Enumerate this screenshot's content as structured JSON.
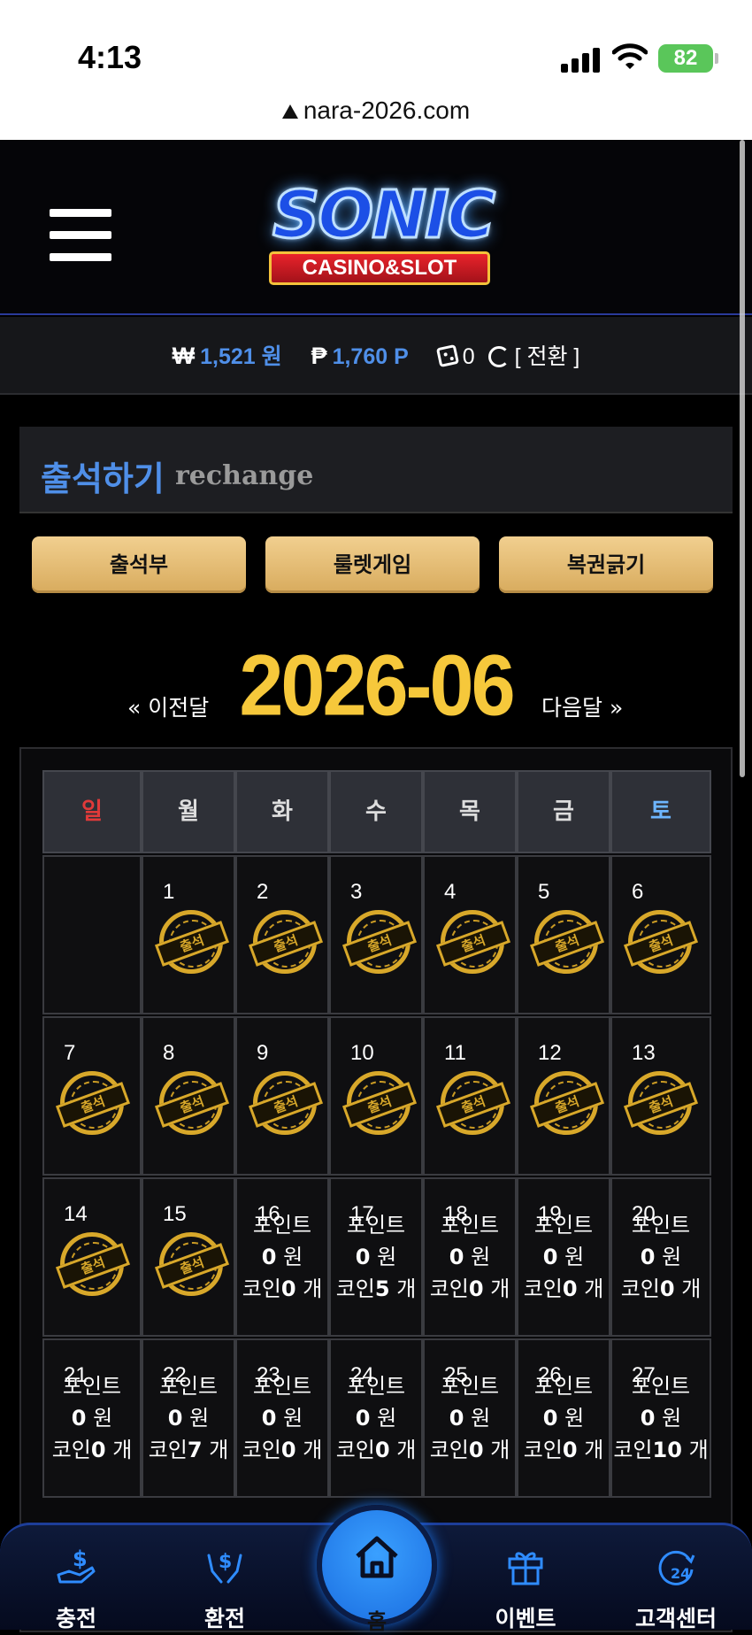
{
  "status": {
    "time": "4:13",
    "battery": "82"
  },
  "browser": {
    "url": "nara-2026.com"
  },
  "logo": {
    "main": "SONIC",
    "sub": "CASINO&SLOT"
  },
  "balance": {
    "won_symbol": "₩",
    "won_value": "1,521 원",
    "point_symbol": "₱",
    "point_value": "1,760 P",
    "coin_value": "0",
    "switch_label": "[ 전환 ]"
  },
  "panel": {
    "title": "출석하기",
    "subtitle": "rechange"
  },
  "tabs": [
    "출석부",
    "룰렛게임",
    "복권긁기"
  ],
  "month_nav": {
    "prev": "« 이전달",
    "current": "2026-06",
    "next": "다음달 »"
  },
  "weekdays": [
    "일",
    "월",
    "화",
    "수",
    "목",
    "금",
    "토"
  ],
  "weekday_colors": {
    "sun": "#e03a3a",
    "sat": "#6db6ff",
    "normal": "#dddddd"
  },
  "stamp_label": "출석",
  "info_labels": {
    "point": "포인트",
    "won_unit": "원",
    "coin": "코인",
    "coin_unit": "개"
  },
  "weeks": [
    [
      null,
      {
        "day": "1",
        "attended": true
      },
      {
        "day": "2",
        "attended": true
      },
      {
        "day": "3",
        "attended": true
      },
      {
        "day": "4",
        "attended": true
      },
      {
        "day": "5",
        "attended": true
      },
      {
        "day": "6",
        "attended": true
      }
    ],
    [
      {
        "day": "7",
        "attended": true
      },
      {
        "day": "8",
        "attended": true
      },
      {
        "day": "9",
        "attended": true
      },
      {
        "day": "10",
        "attended": true
      },
      {
        "day": "11",
        "attended": true
      },
      {
        "day": "12",
        "attended": true
      },
      {
        "day": "13",
        "attended": true
      }
    ],
    [
      {
        "day": "14",
        "attended": true
      },
      {
        "day": "15",
        "attended": true
      },
      {
        "day": "16",
        "attended": false,
        "point": "0",
        "coin": "0"
      },
      {
        "day": "17",
        "attended": false,
        "point": "0",
        "coin": "5"
      },
      {
        "day": "18",
        "attended": false,
        "point": "0",
        "coin": "0"
      },
      {
        "day": "19",
        "attended": false,
        "point": "0",
        "coin": "0"
      },
      {
        "day": "20",
        "attended": false,
        "point": "0",
        "coin": "0"
      }
    ],
    [
      {
        "day": "21",
        "attended": false,
        "point": "0",
        "coin": "0"
      },
      {
        "day": "22",
        "attended": false,
        "point": "0",
        "coin": "7"
      },
      {
        "day": "23",
        "attended": false,
        "point": "0",
        "coin": "0"
      },
      {
        "day": "24",
        "attended": false,
        "point": "0",
        "coin": "0"
      },
      {
        "day": "25",
        "attended": false,
        "point": "0",
        "coin": "0"
      },
      {
        "day": "26",
        "attended": false,
        "point": "0",
        "coin": "0"
      },
      {
        "day": "27",
        "attended": false,
        "point": "0",
        "coin": "10"
      }
    ]
  ],
  "bottom_nav": {
    "items": [
      {
        "label": "충전",
        "icon": "charge-icon"
      },
      {
        "label": "환전",
        "icon": "exchange-icon"
      },
      {
        "label": "이벤트",
        "icon": "gift-icon"
      },
      {
        "label": "고객센터",
        "icon": "support-24-icon"
      }
    ],
    "home": {
      "label": "홈",
      "icon": "home-icon"
    }
  }
}
